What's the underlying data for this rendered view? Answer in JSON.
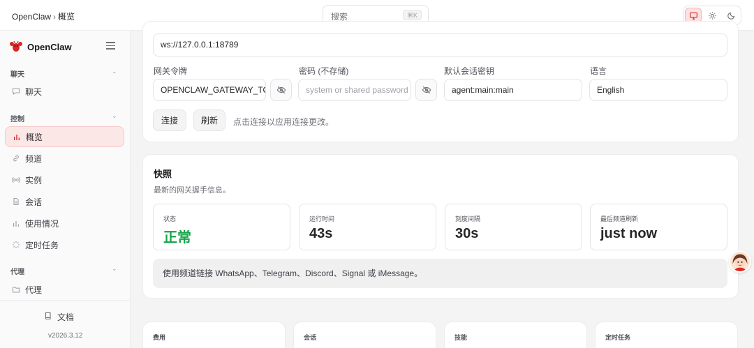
{
  "header": {
    "crumb_root": "OpenClaw",
    "crumb_sep": "›",
    "crumb_current": "概览",
    "search_placeholder": "搜索",
    "search_shortcut": "⌘K",
    "theme_modes": [
      "monitor-icon",
      "sun-icon",
      "moon-icon"
    ],
    "active_mode": "monitor-icon"
  },
  "sidebar": {
    "brand": "OpenClaw",
    "sections": [
      {
        "title": "聊天",
        "items": [
          {
            "label": "聊天",
            "icon": "chat-bubble-icon"
          }
        ]
      },
      {
        "title": "控制",
        "items": [
          {
            "label": "概览",
            "icon": "bar-chart-icon",
            "active": true
          },
          {
            "label": "频道",
            "icon": "link-icon"
          },
          {
            "label": "实例",
            "icon": "radio-icon"
          },
          {
            "label": "会话",
            "icon": "document-icon"
          },
          {
            "label": "使用情况",
            "icon": "usage-bars-icon"
          },
          {
            "label": "定时任务",
            "icon": "spinner-icon"
          }
        ]
      },
      {
        "title": "代理",
        "items": [
          {
            "label": "代理",
            "icon": "folder-icon"
          }
        ]
      }
    ],
    "docs_label": "文档",
    "version": "v2026.3.12"
  },
  "gateway": {
    "url_value": "ws://127.0.0.1:18789",
    "token_label": "网关令牌",
    "token_value": "OPENCLAW_GATEWAY_TOK",
    "password_label": "密码 (不存储)",
    "password_placeholder": "system or shared password",
    "session_key_label": "默认会话密钥",
    "session_key_value": "agent:main:main",
    "language_label": "语言",
    "language_value": "English",
    "connect_label": "连接",
    "refresh_label": "刷新",
    "hint": "点击连接以应用连接更改。"
  },
  "snapshot": {
    "title": "快照",
    "subtitle": "最新的网关握手信息。",
    "stats": [
      {
        "label": "状态",
        "value": "正常",
        "status": "ok"
      },
      {
        "label": "运行时间",
        "value": "43s"
      },
      {
        "label": "刻度间隔",
        "value": "30s"
      },
      {
        "label": "最后频道刷新",
        "value": "just now"
      }
    ],
    "notice": "使用频道链接 WhatsApp、Telegram、Discord、Signal 或 iMessage。"
  },
  "bottom_cards": [
    "费用",
    "会话",
    "技能",
    "定时任务"
  ],
  "colors": {
    "accent": "#dc2626",
    "ok": "#16a34a",
    "active_bg": "#fce7e7"
  }
}
